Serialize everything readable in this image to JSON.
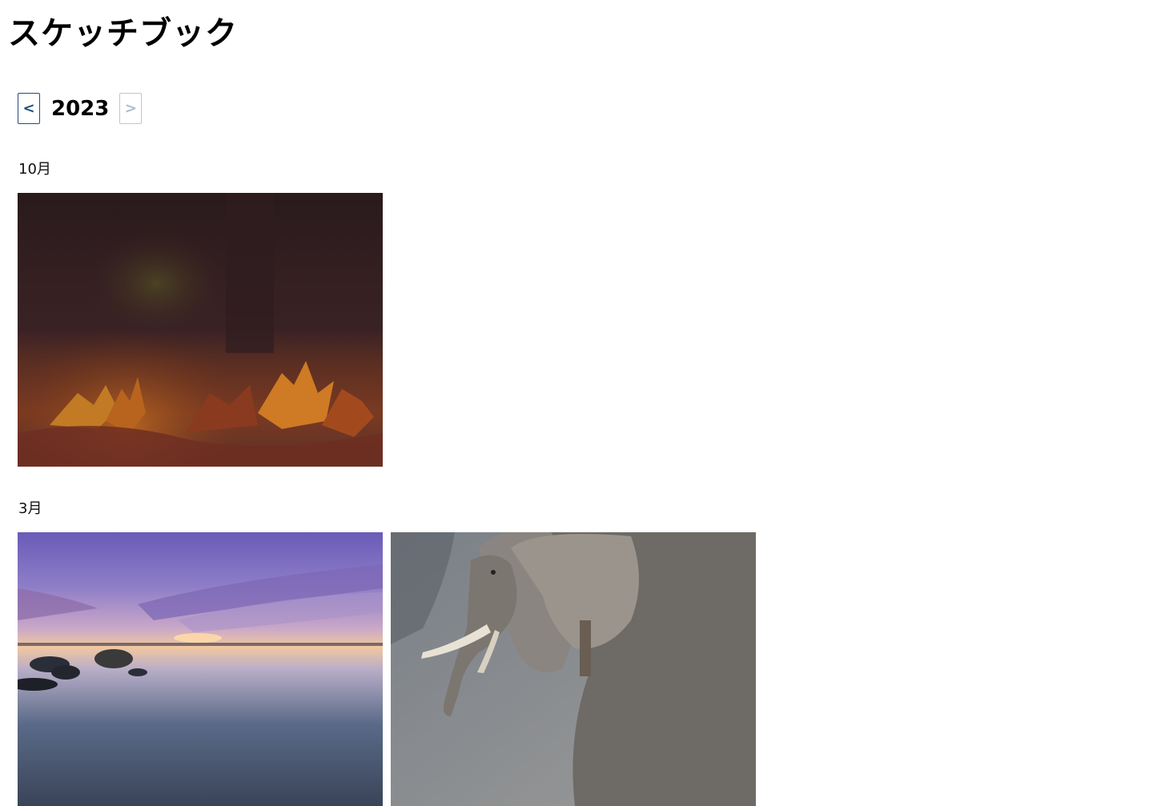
{
  "page": {
    "title": "スケッチブック"
  },
  "year_nav": {
    "prev_label": "<",
    "year": "2023",
    "next_label": ">",
    "next_disabled": true
  },
  "sections": [
    {
      "month": "10月",
      "photos": [
        {
          "subject": "autumn-leaves-photo"
        }
      ]
    },
    {
      "month": "3月",
      "photos": [
        {
          "subject": "seaside-sunset-photo"
        },
        {
          "subject": "elephant-photo"
        }
      ]
    }
  ]
}
